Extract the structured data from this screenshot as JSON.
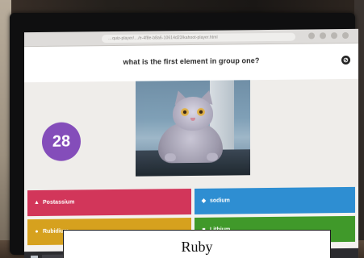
{
  "browser": {
    "url": "…quiz-player/…/e-4f8e-b8a6-10614d23/kahoot-player.html"
  },
  "question": {
    "text": "what is the first element in group one?"
  },
  "timer": {
    "value": "28"
  },
  "answers": [
    {
      "shape": "▲",
      "label": "Postassium",
      "color": "#e21b3c"
    },
    {
      "shape": "◆",
      "label": "sodium",
      "color": "#1368ce"
    },
    {
      "shape": "●",
      "label": "Rubidium",
      "color": "#d89e00"
    },
    {
      "shape": "■",
      "label": "Lithium",
      "color": "#26890c"
    }
  ],
  "caption": {
    "text": "Ruby"
  },
  "colors": {
    "timer_purple": "#864cbf",
    "screen_bg": "#f2f2f2"
  }
}
